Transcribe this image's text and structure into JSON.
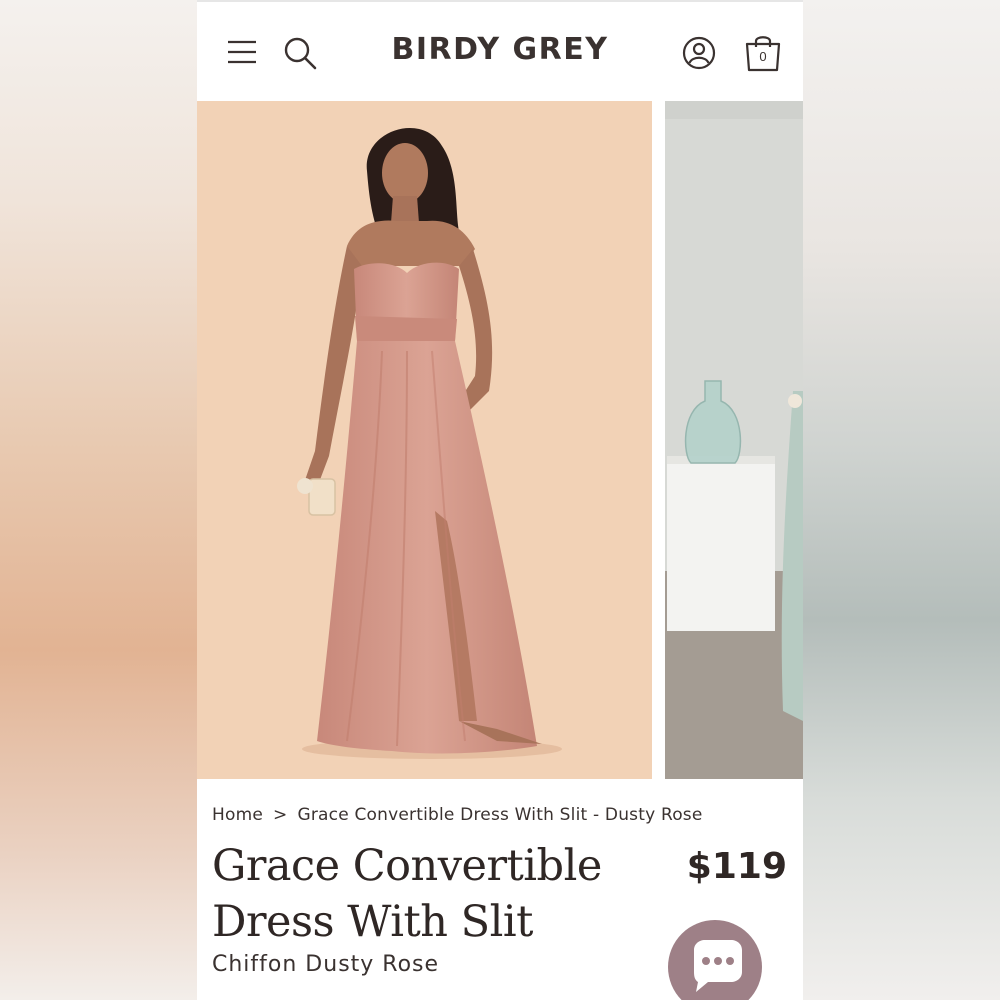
{
  "header": {
    "brand": "BIRDY GREY",
    "cart_count": "0",
    "icons": [
      "menu-icon",
      "search-icon",
      "account-icon",
      "shopping-bag-icon"
    ]
  },
  "gallery": {
    "images": [
      {
        "subject": "model-in-dusty-rose-strapless-gown"
      },
      {
        "subject": "sage-dress-with-glass-vase-on-pedestal"
      }
    ]
  },
  "breadcrumb": {
    "home": "Home",
    "separator": ">",
    "current": "Grace Convertible Dress With Slit - Dusty Rose"
  },
  "product": {
    "title_line1": "Grace Convertible",
    "title_line2": "Dress With Slit",
    "price": "$119",
    "subtitle": "Chiffon Dusty Rose"
  },
  "colors": {
    "text": "#2f2725",
    "chat_button": "#9e8087",
    "main_backdrop": "#f2d2b6",
    "dress": "#d49c88"
  }
}
